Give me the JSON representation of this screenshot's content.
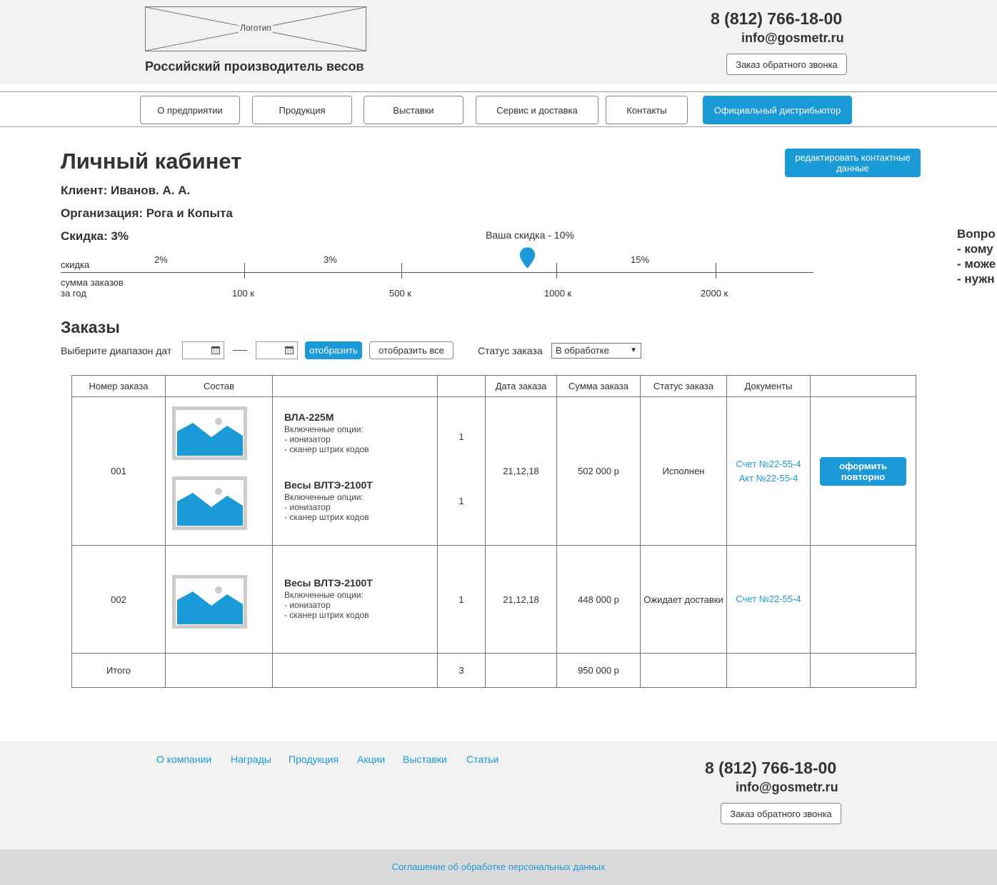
{
  "header": {
    "logo_label": "Логотип",
    "tagline": "Российский производитель весов",
    "phone": "8 (812) 766-18-00",
    "email": "info@gosmetr.ru",
    "callback_label": "Заказ обратного звонка"
  },
  "nav": {
    "items": [
      {
        "label": "О предприятии"
      },
      {
        "label": "Продукция"
      },
      {
        "label": "Выставки"
      },
      {
        "label": "Сервис и доставка"
      },
      {
        "label": "Контакты"
      },
      {
        "label": "Официальный дистрибьютор"
      }
    ],
    "active_index": 5
  },
  "account": {
    "title": "Личный кабинет",
    "edit_label": "редактировать контактные данные",
    "client": "Клиент: Иванов. А. А.",
    "organization": "Организация: Рога и Копыта",
    "discount": "Скидка: 3%"
  },
  "side_note": {
    "lines": [
      "Вопро",
      "- кому",
      "- може",
      "- нужн"
    ]
  },
  "discount_scale": {
    "your_discount": "Ваша скидка - 10%",
    "row1_label": "скидка",
    "row2_label_1": "сумма заказов",
    "row2_label_2": "за год",
    "tiers": [
      "2%",
      "3%",
      "15%"
    ],
    "thresholds": [
      "100 к",
      "500 к",
      "1000 к",
      "2000 к"
    ]
  },
  "orders": {
    "title": "Заказы",
    "date_range_label": "Выберите диапазон дат",
    "show_label": "отобразить",
    "show_all_label": "отобразить все",
    "status_label": "Статус заказа",
    "status_selected": "В обработке",
    "columns": [
      "Номер заказа",
      "Состав",
      "",
      "",
      "Дата заказа",
      "Сумма заказа",
      "Статус заказа",
      "Документы",
      ""
    ],
    "rows": [
      {
        "number": "001",
        "products": [
          {
            "name": "ВЛА-225М",
            "options_title": "Включенные опции:",
            "options": [
              "- ионизатор",
              "- сканер штрих кодов"
            ],
            "qty": "1"
          },
          {
            "name": "Весы ВЛТЭ-2100Т",
            "options_title": "Включенные опции:",
            "options": [
              "- ионизатор",
              "- сканер штрих кодов"
            ],
            "qty": "1"
          }
        ],
        "date": "21,12,18",
        "sum": "502 000 р",
        "status": "Исполнен",
        "docs": [
          "Счет №22-55-4",
          "Акт №22-55-4"
        ],
        "reorder_label": "оформить повторно"
      },
      {
        "number": "002",
        "products": [
          {
            "name": "Весы ВЛТЭ-2100Т",
            "options_title": "Включенные опции:",
            "options": [
              "- ионизатор",
              "- сканер штрих кодов"
            ],
            "qty": "1"
          }
        ],
        "date": "21,12,18",
        "sum": "448 000 р",
        "status": "Ожидает доставки",
        "docs": [
          "Счет №22-55-4"
        ]
      }
    ],
    "total": {
      "label": "Итого",
      "qty": "3",
      "sum": "950 000 р"
    }
  },
  "footer": {
    "links": [
      "О компании",
      "Награды",
      "Продукция",
      "Акции",
      "Выставки",
      "Статьи"
    ],
    "phone": "8 (812) 766-18-00",
    "email": "info@gosmetr.ru",
    "callback_label": "Заказ обратного звонка",
    "agreement": "Соглашение об обработке персональных данных"
  },
  "colors": {
    "accent": "#1a9ad6",
    "header_bg": "#f2f2f2",
    "bottom_bar_bg": "#dadada"
  }
}
